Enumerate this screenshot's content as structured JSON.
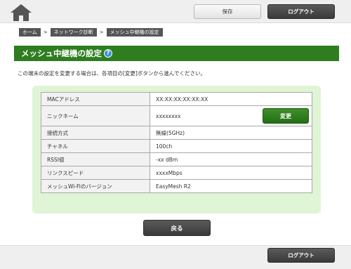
{
  "header": {
    "save_label": "保存",
    "logout_label": "ログアウト"
  },
  "breadcrumb": [
    "ホーム",
    "ネットワーク診断",
    "メッシュ中継機の設定"
  ],
  "breadcrumb_separator": ">",
  "page": {
    "title": "メッシュ中継機の設定",
    "help_symbol": "?",
    "intro": "この端末の設定を変更する場合は、各項目の[変更]ボタンから進んでください。"
  },
  "device_info": {
    "rows": [
      {
        "label": "MACアドレス",
        "value": "XX:XX:XX:XX:XX:XX"
      },
      {
        "label": "ニックネーム",
        "value": "xxxxxxxx",
        "action": "変更"
      },
      {
        "label": "接続方式",
        "value": "無線(5GHz)"
      },
      {
        "label": "チャネル",
        "value": "100ch"
      },
      {
        "label": "RSSI値",
        "value": "-xx dBm"
      },
      {
        "label": "リンクスピード",
        "value": "xxxxMbps"
      },
      {
        "label": "メッシュWi-Fiのバージョン",
        "value": "EasyMesh R2"
      }
    ]
  },
  "footer": {
    "back_label": "戻る",
    "logout_label": "ログアウト"
  },
  "colors": {
    "title_bar": "#2e7d1f",
    "panel_bg": "#dff5d6",
    "dark_button": "#444444",
    "help_icon": "#3a8fd8"
  }
}
